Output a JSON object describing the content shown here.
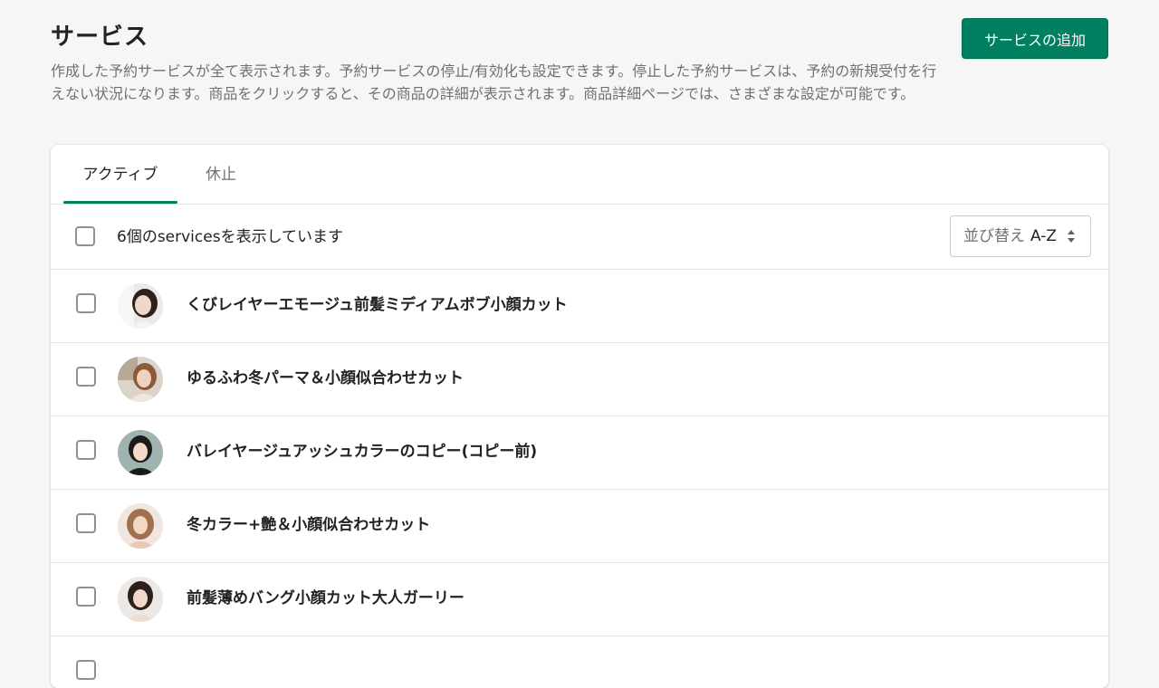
{
  "header": {
    "title": "サービス",
    "description": "作成した予約サービスが全て表示されます。予約サービスの停止/有効化も設定できます。停止した予約サービスは、予約の新規受付を行えない状況になります。商品をクリックすると、その商品の詳細が表示されます。商品詳細ページでは、さまざまな設定が可能です。",
    "add_button_label": "サービスの追加"
  },
  "tabs": [
    {
      "label": "アクティブ",
      "active": true
    },
    {
      "label": "休止",
      "active": false
    }
  ],
  "toolbar": {
    "count_text": "6個のservicesを表示しています",
    "sort_label": "並び替え",
    "sort_value": "A-Z"
  },
  "services": [
    {
      "name": "くびレイヤーエモージュ前髪ミディアムボブ小顔カット",
      "avatar_icon": "person-photo-icon"
    },
    {
      "name": "ゆるふわ冬パーマ＆小顔似合わせカット",
      "avatar_icon": "person-photo-icon"
    },
    {
      "name": "バレイヤージュアッシュカラーのコピー(コピー前)",
      "avatar_icon": "person-photo-icon"
    },
    {
      "name": "冬カラー+艶＆小顔似合わせカット",
      "avatar_icon": "person-photo-icon"
    },
    {
      "name": "前髪薄めバング小顔カット大人ガーリー",
      "avatar_icon": "person-photo-icon"
    }
  ],
  "colors": {
    "primary": "#008060",
    "text": "#202223",
    "subdued": "#6d7175",
    "border": "#e1e3e5",
    "background": "#f6f6f7"
  }
}
